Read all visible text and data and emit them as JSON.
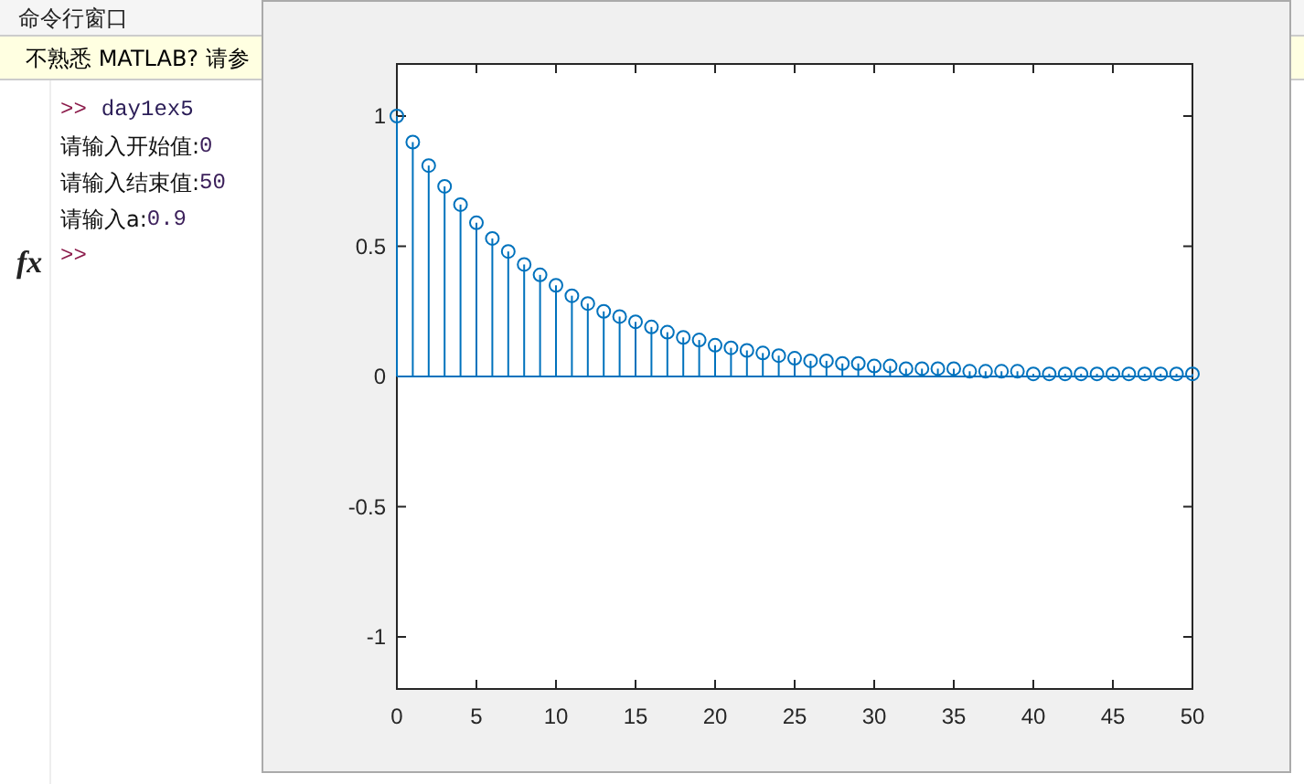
{
  "command_window": {
    "title": "命令行窗口",
    "banner": "不熟悉 MATLAB? 请参",
    "function_icon": "fx",
    "lines": [
      {
        "kind": "command",
        "prompt": ">>",
        "text": "day1ex5"
      },
      {
        "kind": "output",
        "label": "请输入开始值:",
        "value": "0"
      },
      {
        "kind": "output",
        "label": "请输入结束值:",
        "value": "50"
      },
      {
        "kind": "output",
        "label": "请输入a:",
        "value": "0.9"
      },
      {
        "kind": "prompt",
        "prompt": ">>"
      }
    ]
  },
  "figure": {
    "chart_data": {
      "type": "scatter",
      "x": [
        0,
        1,
        2,
        3,
        4,
        5,
        6,
        7,
        8,
        9,
        10,
        11,
        12,
        13,
        14,
        15,
        16,
        17,
        18,
        19,
        20,
        21,
        22,
        23,
        24,
        25,
        26,
        27,
        28,
        29,
        30,
        31,
        32,
        33,
        34,
        35,
        36,
        37,
        38,
        39,
        40,
        41,
        42,
        43,
        44,
        45,
        46,
        47,
        48,
        49,
        50
      ],
      "series": [
        {
          "color": "#0072bd",
          "values": [
            1,
            0.9,
            0.81,
            0.73,
            0.66,
            0.59,
            0.53,
            0.48,
            0.43,
            0.39,
            0.35,
            0.31,
            0.28,
            0.25,
            0.23,
            0.21,
            0.19,
            0.17,
            0.15,
            0.14,
            0.12,
            0.11,
            0.1,
            0.09,
            0.08,
            0.07,
            0.06,
            0.06,
            0.05,
            0.05,
            0.04,
            0.04,
            0.03,
            0.03,
            0.03,
            0.03,
            0.02,
            0.02,
            0.02,
            0.02,
            0.01,
            0.01,
            0.01,
            0.01,
            0.01,
            0.01,
            0.01,
            0.01,
            0.01,
            0.01,
            0.01
          ]
        }
      ],
      "ref_lines": [
        {
          "axis": "y",
          "value": 0,
          "color": "#0072bd"
        }
      ],
      "xlim": [
        0,
        50
      ],
      "ylim": [
        -1.2,
        1.2
      ],
      "xticks": [
        0,
        5,
        10,
        15,
        20,
        25,
        30,
        35,
        40,
        45,
        50
      ],
      "yticks": [
        -1,
        -0.5,
        0,
        0.5,
        1
      ]
    }
  }
}
